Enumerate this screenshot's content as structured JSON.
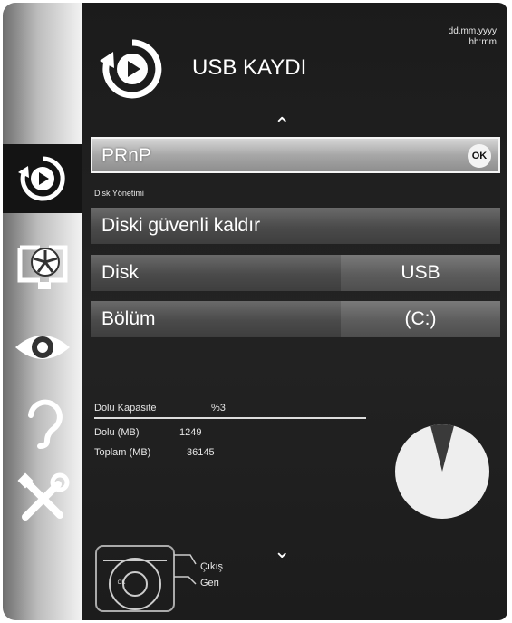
{
  "header": {
    "title": "USB KAYDI",
    "date": "dd.mm.yyyy",
    "time": "hh:mm"
  },
  "sidebar": {
    "items": [
      {
        "icon": "usb-record-icon",
        "active": true
      },
      {
        "icon": "picture-settings-icon",
        "active": false
      },
      {
        "icon": "eye-icon",
        "active": false
      },
      {
        "icon": "ear-icon",
        "active": false
      },
      {
        "icon": "tools-icon",
        "active": false
      }
    ]
  },
  "menu": {
    "prnp_label": "PRnP",
    "ok_label": "OK",
    "section_label": "Disk Yönetimi",
    "safe_remove_label": "Diski güvenli kaldır",
    "disk_label": "Disk",
    "disk_value": "USB",
    "partition_label": "Bölüm",
    "partition_value": "(C:)"
  },
  "stats": {
    "capacity_label": "Dolu Kapasite",
    "capacity_value": "%3",
    "capacity_fraction": 0.03,
    "used_label": "Dolu (MB)",
    "used_value": "1249",
    "total_label": "Toplam (MB)",
    "total_value": "36145"
  },
  "help": {
    "exit_label": "Çıkış",
    "back_label": "Geri",
    "center_label": "OK"
  },
  "colors": {
    "panel": "#1e1e1e",
    "highlight": "#a9a9a9",
    "pie_fill": "#eeeeee",
    "pie_used": "#3a3a3a"
  }
}
